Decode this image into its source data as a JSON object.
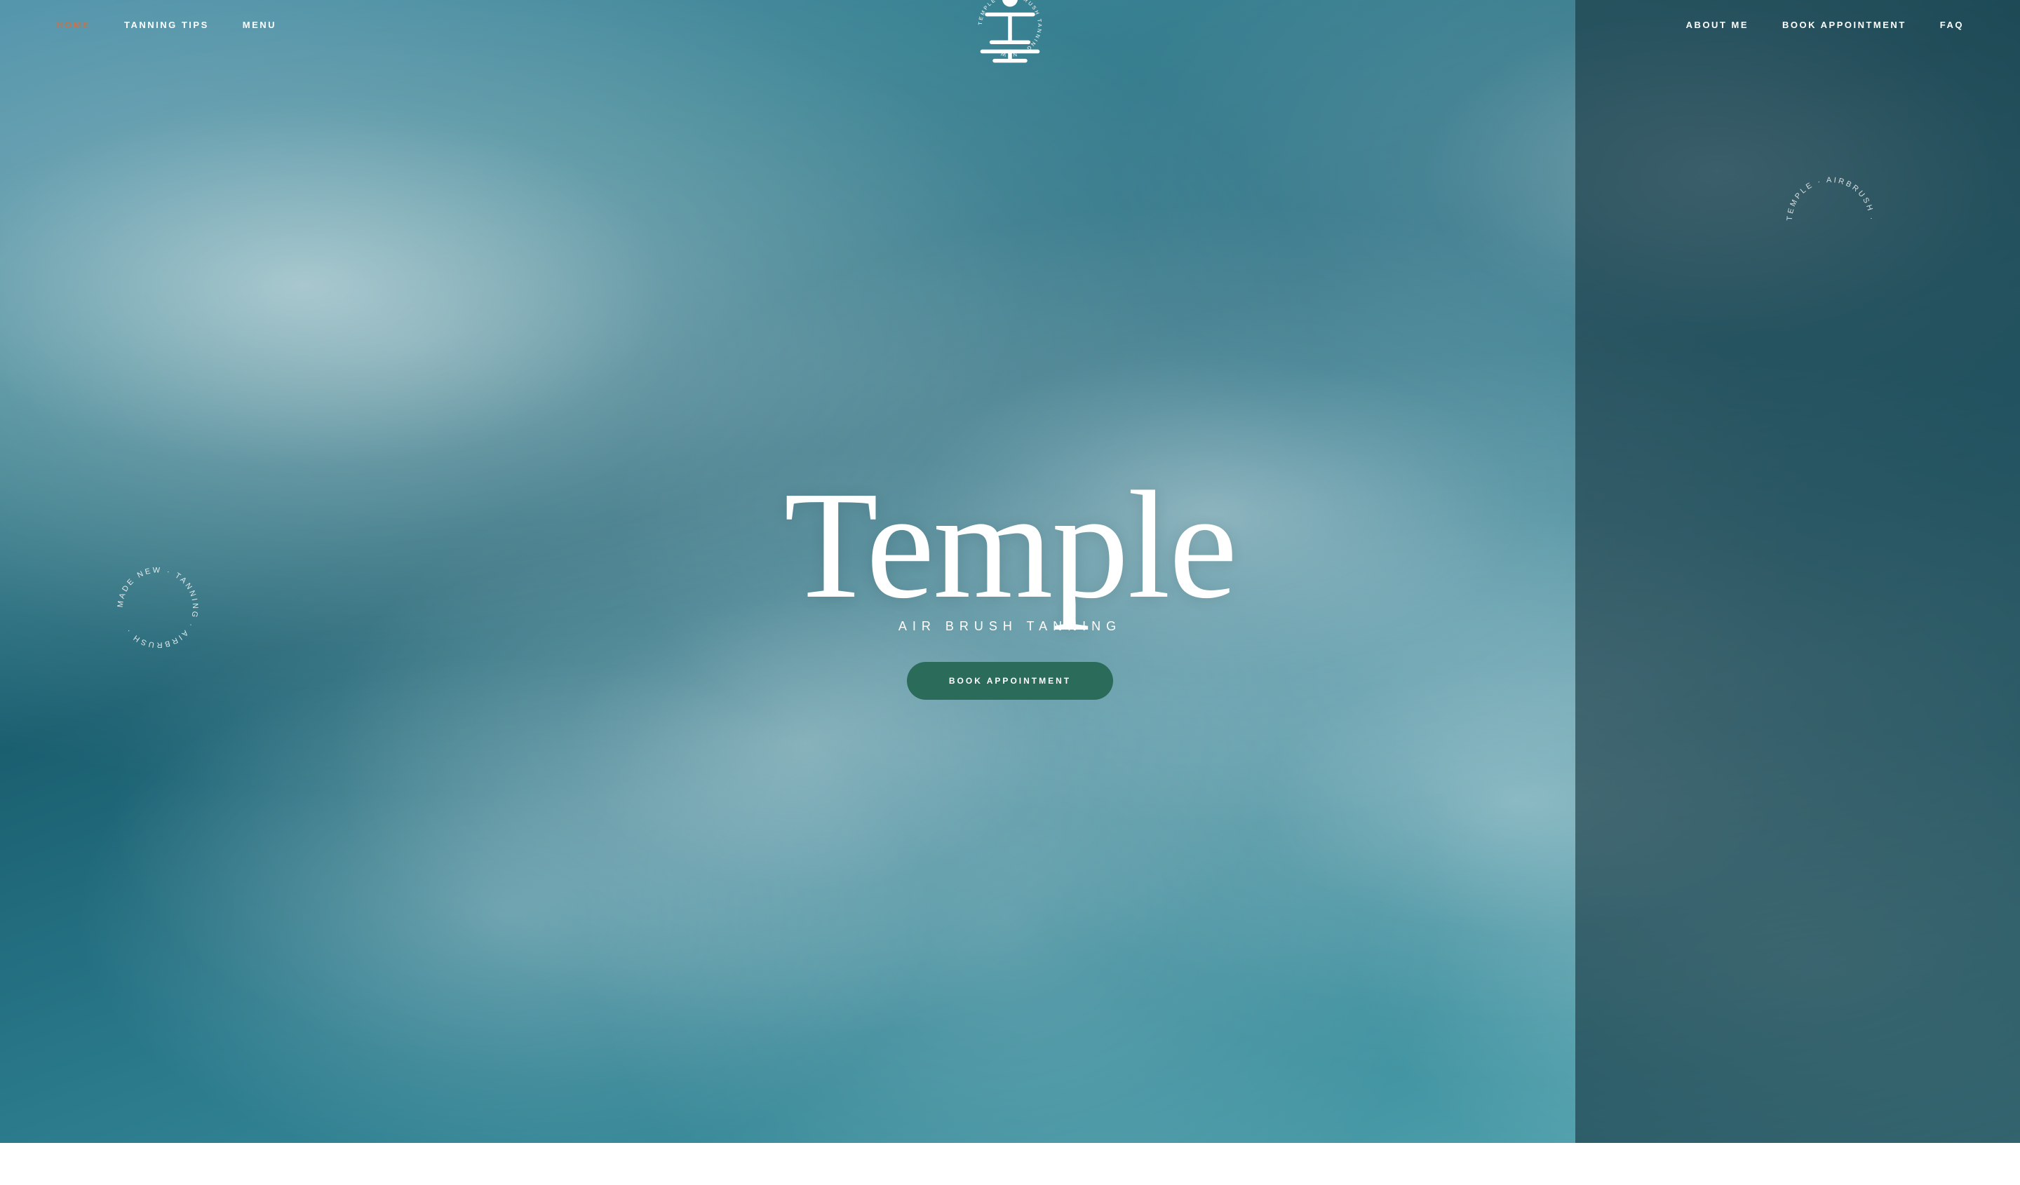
{
  "nav": {
    "left": [
      {
        "id": "home",
        "label": "HOME",
        "active": true
      },
      {
        "id": "tanning-tips",
        "label": "TANNING TIPS",
        "active": false
      },
      {
        "id": "menu",
        "label": "MENU",
        "active": false
      }
    ],
    "right": [
      {
        "id": "about-me",
        "label": "ABOUT ME",
        "active": false
      },
      {
        "id": "book-appointment",
        "label": "BOOK APPOINTMENT",
        "active": false
      },
      {
        "id": "faq",
        "label": "FAQ",
        "active": false
      }
    ]
  },
  "logo": {
    "circular_text": "TEMPLE · AIRBRUSH TANNING · NEW ·",
    "alt": "Temple Airbrush Tanning Logo"
  },
  "hero": {
    "main_title": "Temple",
    "subtitle": "AIR  BRUSH  TANNING",
    "tagline_left": "MADE NEW",
    "tagline_right": "MADE NEW",
    "cta_button": "BOOK APPOINTMENT"
  },
  "circular_elements": {
    "left": "MADE NEW · TANNING · AIRBRUSH ·",
    "right": "TEMPLE · AIRBRUSH ·"
  },
  "colors": {
    "accent_orange": "#c8724a",
    "accent_teal": "#2a6b5a",
    "text_white": "#ffffff",
    "ocean_dark": "#1a5f70",
    "ocean_mid": "#2d7a8a"
  }
}
